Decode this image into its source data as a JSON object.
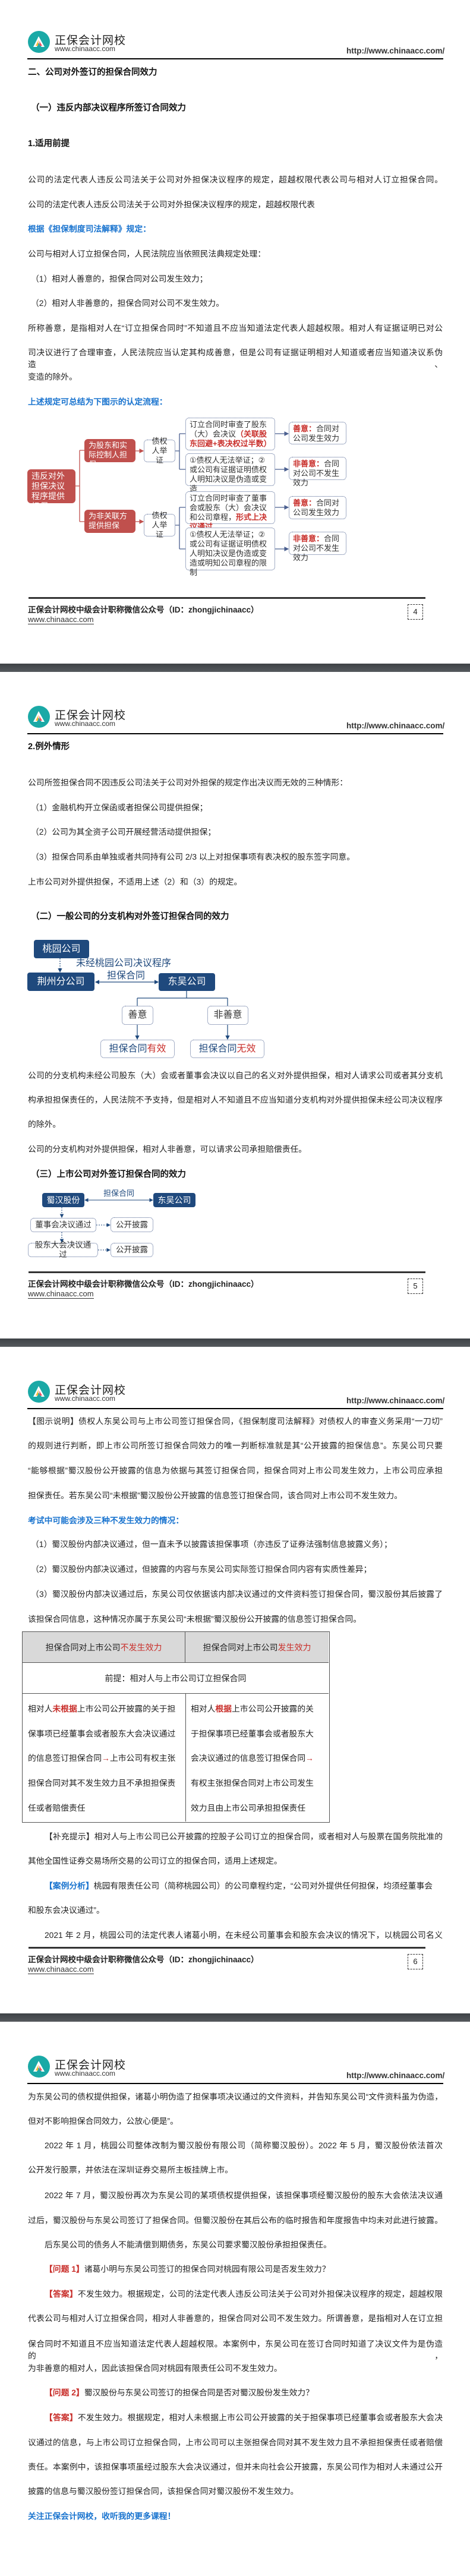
{
  "header": {
    "logo_name": "正保会计网校",
    "logo_url": "www.chinaacc.com",
    "site_url": "http://www.chinaacc.com/"
  },
  "footer": {
    "wechat": "正保会计网校中级会计职称微信公众号（ID：zhongjichinaacc）",
    "site": "www.chinaacc.com"
  },
  "p1": {
    "page_number": "4",
    "lines": [
      "二、公司对外签订的担保合同效力",
      "（一）违反内部决议程序所签订合同效力",
      "1.适用前提",
      "公司的法定代表人违反公司法关于公司对外担保决议程序的规定，超越权限代表公司与相对人订立担保合同。",
      "公司的法定代表人违反公司法关于公司对外担保决议程序的规定，超越权限代表",
      "根据《担保制度司法解释》规定：",
      "公司与相对人订立担保合同，人民法院应当依照民法典规定处理：",
      "（1）相对人善意的，担保合同对公司发生效力；",
      "（2）相对人非善意的，担保合同对公司不发生效力。",
      "所称善意，是指相对人在“订立担保合同时”不知道且不应当知道法定代表人超越权限。相对人有证据证明已对公",
      "司决议进行了合理审查，人民法院应当认定其构成善意，但是公司有证据证明相对人知道或者应当知道决议系伪造、",
      "变造的除外。",
      "上述规定可总结为下图示的认定流程："
    ],
    "flow": {
      "root": "违反对外担保决议程序提供担保",
      "branch_related": "为股东和实际控制人担保",
      "branch_unrelated": "为非关联方提供担保",
      "creditor_proof": "债权人举证",
      "a_text": "订立合同时审查了股东（大）会决议",
      "a_red": "（关联股东回避+表决权过半数）",
      "b_text": "①债权人无法举证；②或公司有证据证明债权人明知决议是伪造或变造",
      "c_text": "订立合同时审查了董事会或股东（大）会决议和公司章程，",
      "c_red": "形式上决议通过",
      "d_text": "①债权人无法举证；②或公司有证据证明债权人明知决议是伪造或变造或明知公司章程的限制",
      "good_label": "善意：",
      "good_result": "合同对公司发生效力",
      "bad_label": "非善意：",
      "bad_result": "合同对公司不发生效力"
    }
  },
  "p2": {
    "page_number": "5",
    "lines": [
      "2.例外情形",
      "公司所签担保合同不因违反公司法关于公司对外担保的规定作出决议而无效的三种情形：",
      "（1）金融机构开立保函或者担保公司提供担保；",
      "（2）公司为其全资子公司开展经营活动提供担保；",
      "（3）担保合同系由单独或者共同持有公司 2/3 以上对担保事项有表决权的股东签字同意。",
      "上市公司对外提供担保，不适用上述（2）和（3）的规定。",
      "（二）一般公司的分支机构对外签订担保合同的效力",
      "公司的分支机构未经公司股东（大）会或者董事会决议以自己的名义对外提供担保，相对人请求公司或者其分支机",
      "构承担担保责任的，人民法院不予支持，但是相对人不知道且不应当知道分支机构对外提供担保未经公司决议程序",
      "的除外。",
      "公司的分支机构对外提供担保，相对人非善意，可以请求公司承担赔偿责任。",
      "（三）上市公司对外签订担保合同的效力"
    ],
    "branch_diagram": {
      "parent": "桃园公司",
      "branch": "荆州分公司",
      "counterparty": "东吴公司",
      "note_line1": "未经桃园公司决议程序",
      "note_line2": "担保合同",
      "good": "善意",
      "bad": "非善意",
      "result_prefix": "担保合同",
      "valid": "有效",
      "invalid": "无效"
    },
    "listed_diagram": {
      "listed": "蜀汉股份",
      "counterparty": "东吴公司",
      "contract": "担保合同",
      "board": "董事会决议通过",
      "shareholders": "股东大会决议通过",
      "disclose": "公开披露"
    }
  },
  "p3": {
    "page_number": "6",
    "lines": [
      "【图示说明】债权人东吴公司与上市公司签订担保合同，《担保制度司法解释》对债权人的审查义务采用“一刀切”",
      "的规则进行判断，即上市公司所签订担保合同效力的唯一判断标准就是其“公开披露的担保信息”。东吴公司只要",
      "“能够根据”蜀汉股份公开披露的信息为依据与其签订担保合同，担保合同对上市公司发生效力，上市公司应承担",
      "担保责任。若东吴公司“未根据”蜀汉股份公开披露的信息签订担保合同，该合同对上市公司不发生效力。",
      "考试中可能会涉及三种不发生效力的情况：",
      "（1）蜀汉股份内部决议通过，但一直未予以披露该担保事项（亦违反了证券法强制信息披露义务）；",
      "（2）蜀汉股份内部决议通过，但披露的内容与东吴公司实际签订担保合同内容有实质性差异；",
      "（3）蜀汉股份内部决议通过后，东吴公司仅依据该内部决议通过的文件资料签订担保合同，蜀汉股份其后披露了",
      "该担保合同信息，这种情况亦属于东吴公司“未根据”蜀汉股份公开披露的信息签订担保合同。",
      "【补充提示】相对人与上市公司已公开披露的控股子公司订立的担保合同，或者相对人与股票在国务院批准的",
      "其他全国性证券交易场所交易的公司订立的担保合同，适用上述规定。",
      "【案例分析】",
      "桃园有限责任公司（简称桃园公司）的公司章程约定，“公司对外提供任何担保，均须经董事会",
      "和股东会决议通过”。",
      "2021 年 2 月，桃园公司的法定代表人诸葛小明，在未经公司董事会和股东会决议的情况下，以桃园公司名义"
    ],
    "table": {
      "head_prefix": "担保合同对上市公司",
      "head_left_red": "不发生效力",
      "head_right_red": "发生效力",
      "premise": "前提：相对人与上市公司订立担保合同",
      "left": {
        "l1a": "相对人",
        "l1b": "未根据",
        "l1c": "上市公司公开披露的关于担",
        "l2": "保事项已经董事会或者股东大会决议通过",
        "l3a": "的信息签订担保合同",
        "arrow": "→",
        "l3b": "上市公司有权主张",
        "l4": "担保合同对其不发生效力且不承担担保责",
        "l5": "任或者赔偿责任"
      },
      "right": {
        "l1a": "相对人",
        "l1b": "根据",
        "l1c": "上市公司公开披露的关",
        "l2": "于担保事项已经董事会或者股东大",
        "l3a": "会决议通过的信息签订担保合同",
        "arrow": "→",
        "l4": "有权主张担保合同对上市公司发生",
        "l5": "效力且由上市公司承担担保责任"
      }
    }
  },
  "p4": {
    "lines": [
      "为东吴公司的债权提供担保，诸葛小明伪造了担保事项决议通过的文件资料，并告知东吴公司“文件资料虽为伪造，",
      "但对不影响担保合同效力，公放心便是”。",
      "2022 年 1 月，桃园公司整体改制为蜀汉股份有限公司（简称蜀汉股份）。2022 年 5 月，蜀汉股份依法首次",
      "公开发行股票，并依法在深圳证券交易所主板挂牌上市。",
      "2022 年 7 月，蜀汉股份再次为东吴公司的某项债权提供担保，该担保事项经蜀汉股份的股东大会依法决议通",
      "过后，蜀汉股份与东吴公司签订了担保合同。但蜀汉股份在其后公布的临时报告和年度报告中均未对此进行披露。",
      "后东吴公司的债务人不能清偿到期债务，东吴公司要求蜀汉股份承担担保责任。",
      "诸葛小明与东吴公司签订的担保合同对桃园有限公司是否发生效力？",
      "不发生效力。根据规定，公司的法定代表人违反公司法关于公司对外担保决议程序的规定，超越权限",
      "代表公司与相对人订立担保合同，相对人非善意的，担保合同对公司不发生效力。所谓善意，是指相对人在订立担",
      "保合同时不知道且不应当知道法定代表人超越权限。本案例中，东吴公司在签订合同时知道了决议文件为是伪造的，",
      "为非善意的相对人，因此该担保合同对桃园有限责任公司不发生效力。",
      "蜀汉股份与东吴公司签订的担保合同是否对蜀汉股份发生效力？",
      "不发生效力。根据规定，相对人未根据上市公司公开披露的关于担保事项已经董事会或者股东大会决",
      "议通过的信息，与上市公司订立担保合同，上市公司可以主张担保合同对其不发生效力且不承担担保责任或者赔偿",
      "责任。本案例中，该担保事项虽经过股东大会决议通过，但并未向社会公开披露，东吴公司作为相对人未通过公开",
      "披露的信息与蜀汉股份签订担保合同，该担保合同对蜀汉股份不发生效力。",
      "关注正保会计网校，收听我的更多课程！"
    ],
    "q1_label": "【问题 1】",
    "q2_label": "【问题 2】",
    "answer_label": "【答案】"
  },
  "colors": {
    "accent_blue": "#1a74cf",
    "flow_red": "#c0504d",
    "diagram_navy": "#1f497d",
    "highlight_red": "#c9302c",
    "logo_teal": "#1aa9a6"
  },
  "icons": [
    "chinaacc-logo-icon",
    "arrow-icon"
  ]
}
